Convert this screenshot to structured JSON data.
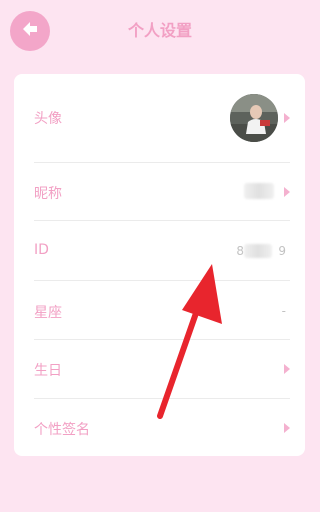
{
  "header": {
    "title": "个人设置"
  },
  "rows": [
    {
      "label": "头像"
    },
    {
      "label": "昵称"
    },
    {
      "label": "ID",
      "value": "8—9",
      "value_left": "8",
      "value_right": "9"
    },
    {
      "label": "星座",
      "value": "-"
    },
    {
      "label": "生日"
    },
    {
      "label": "个性签名"
    }
  ],
  "colors": {
    "background": "#fde4f1",
    "accent": "#f2a0c4",
    "card": "#ffffff",
    "annotation_arrow": "#e8252d"
  }
}
